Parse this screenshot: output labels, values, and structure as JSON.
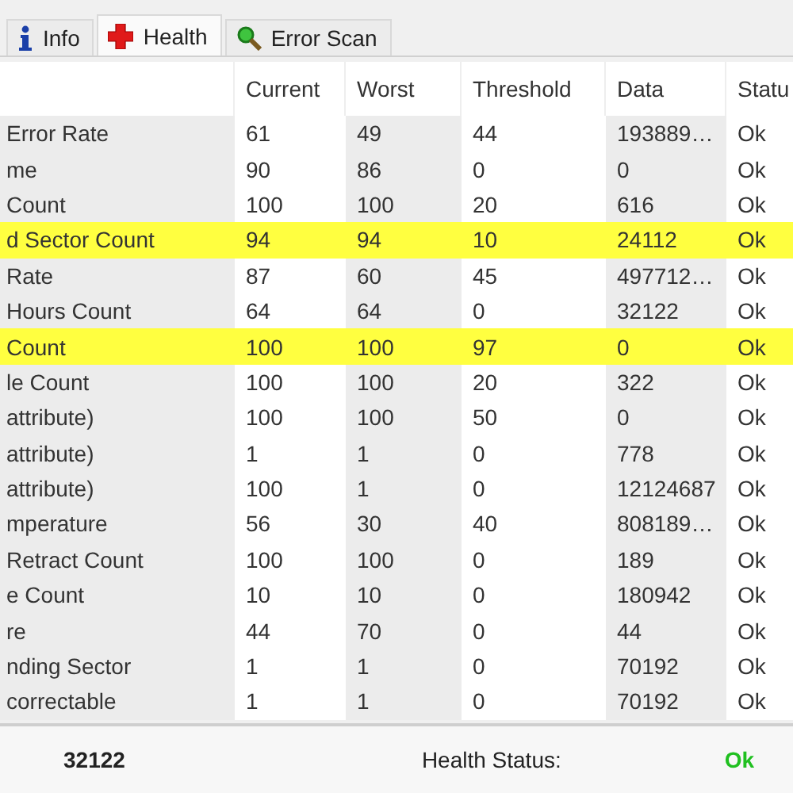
{
  "tabs": [
    {
      "label": "Info",
      "selected": false
    },
    {
      "label": "Health",
      "selected": true
    },
    {
      "label": "Error Scan",
      "selected": false
    }
  ],
  "table": {
    "columns": [
      "Current",
      "Worst",
      "Threshold",
      "Data",
      "Statu"
    ],
    "rows": [
      {
        "name": "Error Rate",
        "cells": [
          "61",
          "49",
          "44",
          "193889…",
          "Ok"
        ],
        "highlighted": false
      },
      {
        "name": "me",
        "cells": [
          "90",
          "86",
          "0",
          "0",
          "Ok"
        ],
        "highlighted": false
      },
      {
        "name": "Count",
        "cells": [
          "100",
          "100",
          "20",
          "616",
          "Ok"
        ],
        "highlighted": false
      },
      {
        "name": "d Sector Count",
        "cells": [
          "94",
          "94",
          "10",
          "24112",
          "Ok"
        ],
        "highlighted": true
      },
      {
        "name": "Rate",
        "cells": [
          "87",
          "60",
          "45",
          "497712…",
          "Ok"
        ],
        "highlighted": false
      },
      {
        "name": "Hours Count",
        "cells": [
          "64",
          "64",
          "0",
          "32122",
          "Ok"
        ],
        "highlighted": false
      },
      {
        "name": "Count",
        "cells": [
          "100",
          "100",
          "97",
          "0",
          "Ok"
        ],
        "highlighted": true
      },
      {
        "name": "le Count",
        "cells": [
          "100",
          "100",
          "20",
          "322",
          "Ok"
        ],
        "highlighted": false
      },
      {
        "name": "attribute)",
        "cells": [
          "100",
          "100",
          "50",
          "0",
          "Ok"
        ],
        "highlighted": false
      },
      {
        "name": "attribute)",
        "cells": [
          "1",
          "1",
          "0",
          "778",
          "Ok"
        ],
        "highlighted": false
      },
      {
        "name": "attribute)",
        "cells": [
          "100",
          "1",
          "0",
          "12124687",
          "Ok"
        ],
        "highlighted": false
      },
      {
        "name": "mperature",
        "cells": [
          "56",
          "30",
          "40",
          "808189…",
          "Ok"
        ],
        "highlighted": false
      },
      {
        "name": "Retract Count",
        "cells": [
          "100",
          "100",
          "0",
          "189",
          "Ok"
        ],
        "highlighted": false
      },
      {
        "name": "e Count",
        "cells": [
          "10",
          "10",
          "0",
          "180942",
          "Ok"
        ],
        "highlighted": false
      },
      {
        "name": "re",
        "cells": [
          "44",
          "70",
          "0",
          "44",
          "Ok"
        ],
        "highlighted": false
      },
      {
        "name": "nding Sector",
        "cells": [
          "1",
          "1",
          "0",
          "70192",
          "Ok"
        ],
        "highlighted": false
      },
      {
        "name": "correctable",
        "cells": [
          "1",
          "1",
          "0",
          "70192",
          "Ok"
        ],
        "highlighted": false
      }
    ]
  },
  "footer": {
    "hours": "32122",
    "health_label": "Health Status:",
    "health_value": "Ok"
  }
}
